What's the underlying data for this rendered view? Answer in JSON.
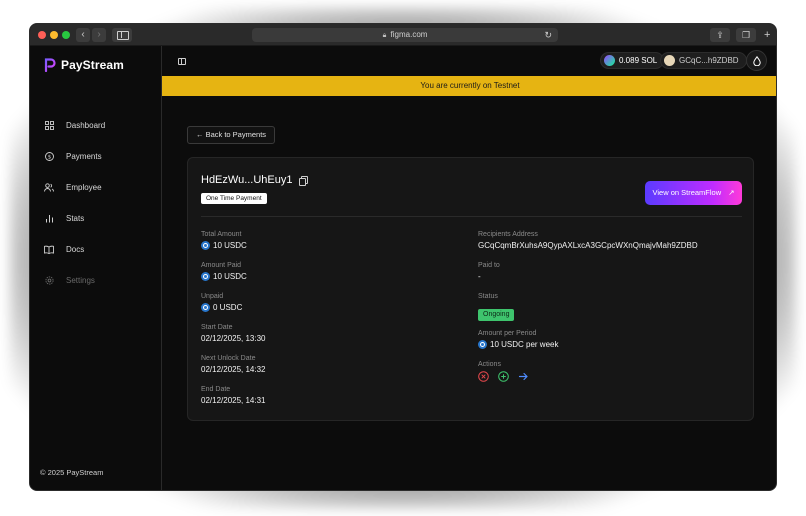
{
  "browser": {
    "url": "figma.com"
  },
  "app": {
    "brand": "PayStream",
    "copyright": "© 2025 PayStream"
  },
  "sidebar": {
    "items": [
      {
        "label": "Dashboard",
        "icon": "grid-icon",
        "enabled": true
      },
      {
        "label": "Payments",
        "icon": "dollar-circle-icon",
        "enabled": true
      },
      {
        "label": "Employee",
        "icon": "users-icon",
        "enabled": true
      },
      {
        "label": "Stats",
        "icon": "bar-chart-icon",
        "enabled": true
      },
      {
        "label": "Docs",
        "icon": "book-icon",
        "enabled": true
      },
      {
        "label": "Settings",
        "icon": "gear-icon",
        "enabled": false
      }
    ]
  },
  "header": {
    "sol_balance": "0.089 SOL",
    "wallet_address": "GCqC...h9ZDBD"
  },
  "banner": {
    "text": "You are currently on Testnet",
    "color": "#e6b412"
  },
  "page": {
    "back_label": "← Back to Payments",
    "stream_id": "HdEzWu...UhEuy1",
    "payment_type": "One Time Payment",
    "streamflow_label": "View on StreamFlow",
    "left_fields": [
      {
        "label": "Total Amount",
        "value": "10 USDC",
        "token": true
      },
      {
        "label": "Amount Paid",
        "value": "10 USDC",
        "token": true
      },
      {
        "label": "Unpaid",
        "value": "0 USDC",
        "token": true
      },
      {
        "label": "Start Date",
        "value": "02/12/2025, 13:30",
        "token": false
      },
      {
        "label": "Next Unlock Date",
        "value": "02/12/2025, 14:32",
        "token": false
      },
      {
        "label": "End Date",
        "value": "02/12/2025, 14:31",
        "token": false
      }
    ],
    "right": {
      "recipients_label": "Recipients Address",
      "recipients_value": "GCqCqmBrXuhsA9QypAXLxcA3GCpcWXnQmajvMah9ZDBD",
      "paid_to_label": "Paid to",
      "paid_to_value": "-",
      "status_label": "Status",
      "status_value": "Ongoing",
      "amount_period_label": "Amount per Period",
      "amount_period_value": "10 USDC per week",
      "actions_label": "Actions"
    },
    "colors": {
      "status": "#3ec46d",
      "cancel": "#e5484d",
      "add": "#3ec46d",
      "forward": "#4f8cff"
    }
  }
}
